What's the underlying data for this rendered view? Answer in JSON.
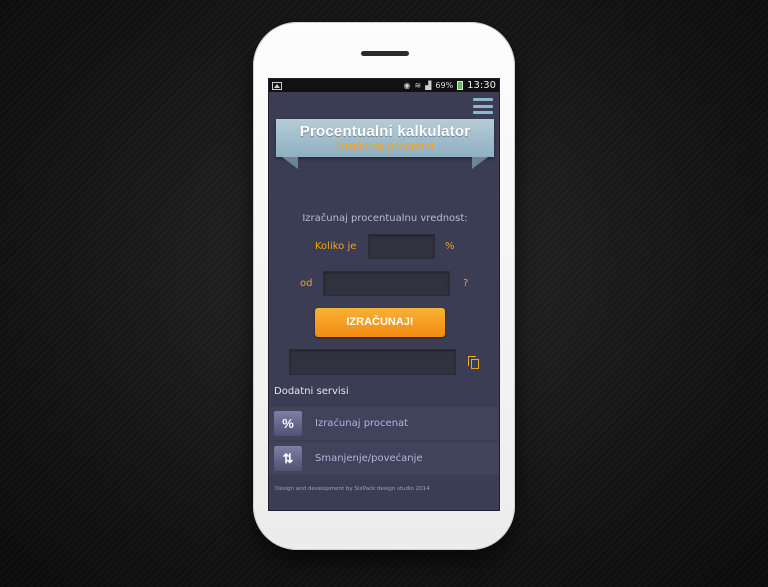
{
  "statusbar": {
    "battery_text": "69%",
    "time": "13:30",
    "icons": [
      "image-icon",
      "eye-icon",
      "wifi-icon",
      "signal-icon",
      "battery-icon"
    ],
    "battery_color": "#5cc24b"
  },
  "header": {
    "title": "Procentualni kalkulator",
    "subtitle": "Izračunaj procenat"
  },
  "form": {
    "heading": "Izračunaj procentualnu vrednost:",
    "label_koliko": "Koliko je",
    "suffix_percent": "%",
    "label_od": "od",
    "suffix_question": "?",
    "value_percent": "",
    "value_base": "",
    "button_label": "IZRAČUNAJ!",
    "result_value": ""
  },
  "services": {
    "title": "Dodatni servisi",
    "items": [
      {
        "icon_text": "%",
        "icon": "percent-icon",
        "label": "Izraćunaj procenat"
      },
      {
        "icon_text": "⇅",
        "icon": "up-down-arrows-icon",
        "label": "Smanjenje/povećanje"
      }
    ]
  },
  "footer": {
    "text": "Design and development by SixPack design studio 2014"
  },
  "colors": {
    "accent": "#f0a41a",
    "screen_bg": "#3a3d54",
    "banner": "#9fbccb"
  }
}
